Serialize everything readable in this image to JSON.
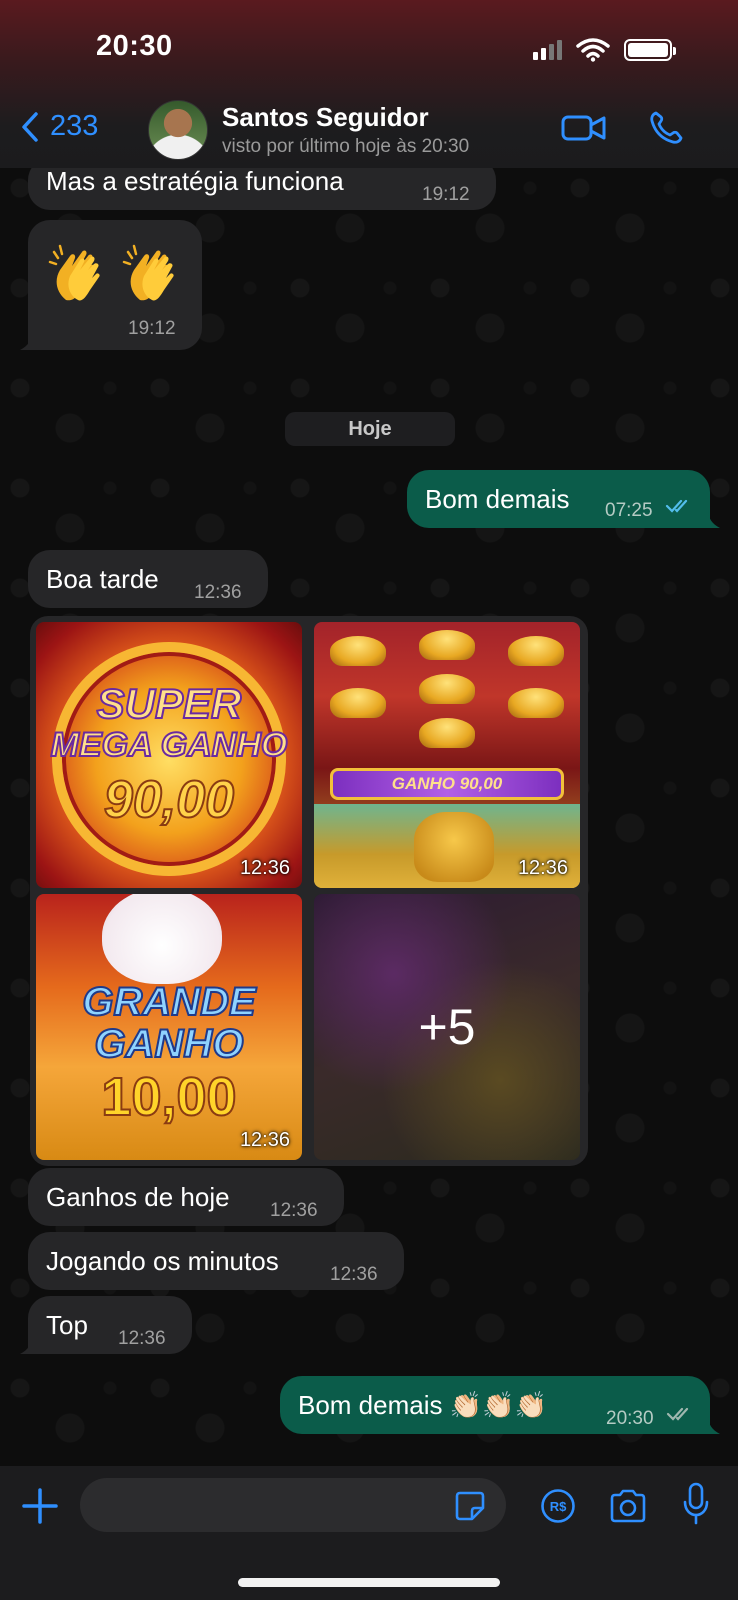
{
  "status_bar": {
    "time": "20:30"
  },
  "header": {
    "back_count": "233",
    "contact_name": "Santos Seguidor",
    "contact_status": "visto por último hoje às 20:30"
  },
  "messages": [
    {
      "text": "Mas a estratégia funciona",
      "time": "19:12",
      "direction": "in"
    },
    {
      "text": "👏 👏",
      "time": "19:12",
      "direction": "in"
    },
    {
      "text": "Bom demais",
      "time": "07:25",
      "direction": "out",
      "read": true
    },
    {
      "text": "Boa tarde",
      "time": "12:36",
      "direction": "in"
    },
    {
      "text": "Ganhos de hoje",
      "time": "12:36",
      "direction": "in"
    },
    {
      "text": "Jogando os minutos",
      "time": "12:36",
      "direction": "in"
    },
    {
      "text": "Top",
      "time": "12:36",
      "direction": "in"
    },
    {
      "text": "Bom demais 👏🏻👏🏻👏🏻",
      "time": "20:30",
      "direction": "out",
      "read": false
    }
  ],
  "day_separator": "Hoje",
  "media": {
    "tiles": [
      {
        "line1": "SUPER",
        "line2": "MEGA GANHO",
        "line3": "90,00",
        "time": "12:36"
      },
      {
        "banner": "GANHO 90,00",
        "time": "12:36"
      },
      {
        "line1": "GRANDE",
        "line2": "GANHO",
        "line3": "10,00",
        "time": "12:36"
      }
    ],
    "more_count": "+5"
  },
  "input": {
    "placeholder": "",
    "value": ""
  },
  "colors": {
    "accent": "#2f8fff",
    "incoming_bubble": "#262628",
    "outgoing_bubble": "#0b5c4a",
    "read_tick": "#53bdeb"
  }
}
